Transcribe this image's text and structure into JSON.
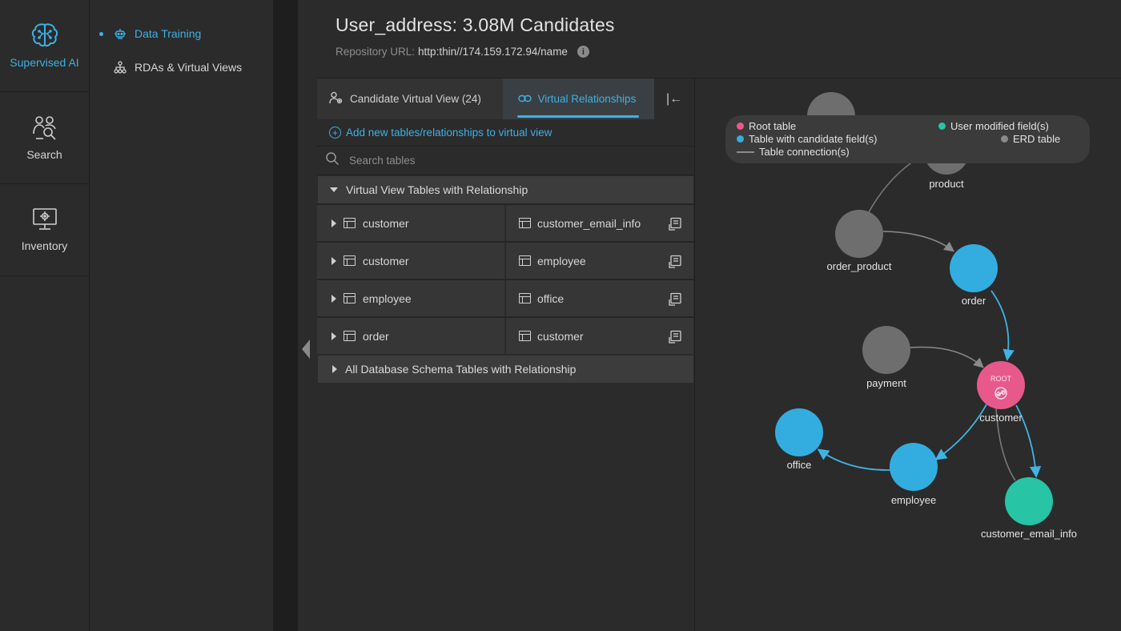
{
  "rail": {
    "items": [
      {
        "label": "Supervised AI",
        "icon": "brain-icon",
        "active": true
      },
      {
        "label": "Search",
        "icon": "people-search-icon",
        "active": false
      },
      {
        "label": "Inventory",
        "icon": "monitor-gear-icon",
        "active": false
      }
    ]
  },
  "subnav": {
    "items": [
      {
        "label": "Data Training",
        "icon": "robot-icon",
        "active": true
      },
      {
        "label": "RDAs & Virtual Views",
        "icon": "hierarchy-icon",
        "active": false
      }
    ]
  },
  "header": {
    "title": "User_address: 3.08M Candidates",
    "repo_label": "Repository URL:",
    "repo_value": "http:thin//174.159.172.94/name"
  },
  "tabs": {
    "candidate": "Candidate Virtual View (24)",
    "relationships": "Virtual Relationships",
    "collapse": "|←"
  },
  "add_link": "Add new tables/relationships to virtual view",
  "search": {
    "placeholder": "Search tables"
  },
  "section_vv": "Virtual View Tables with Relationship",
  "relationships": [
    {
      "left": "customer",
      "right": "customer_email_info"
    },
    {
      "left": "customer",
      "right": "employee"
    },
    {
      "left": "employee",
      "right": "office"
    },
    {
      "left": "order",
      "right": "customer"
    }
  ],
  "section_all": "All Database Schema Tables with Relationship",
  "legend": {
    "root": "Root table",
    "candidate": "Table with candidate field(s)",
    "connection": "Table connection(s)",
    "user_modified": "User modified field(s)",
    "erd": "ERD table"
  },
  "colors": {
    "accent": "#3db1e3",
    "root": "#e8598b",
    "candidate": "#33ade0",
    "user_modified": "#27c4a6",
    "erd": "#6e6e6e"
  },
  "graph": {
    "root_badge": "ROOT",
    "nodes": [
      {
        "id": "product",
        "label": "product",
        "kind": "erd"
      },
      {
        "id": "order_product",
        "label": "order_product",
        "kind": "erd"
      },
      {
        "id": "order",
        "label": "order",
        "kind": "candidate"
      },
      {
        "id": "payment",
        "label": "payment",
        "kind": "erd"
      },
      {
        "id": "customer",
        "label": "customer",
        "kind": "root"
      },
      {
        "id": "office",
        "label": "office",
        "kind": "candidate"
      },
      {
        "id": "employee",
        "label": "employee",
        "kind": "candidate"
      },
      {
        "id": "customer_email_info",
        "label": "customer_email_info",
        "kind": "user_modified"
      }
    ]
  }
}
